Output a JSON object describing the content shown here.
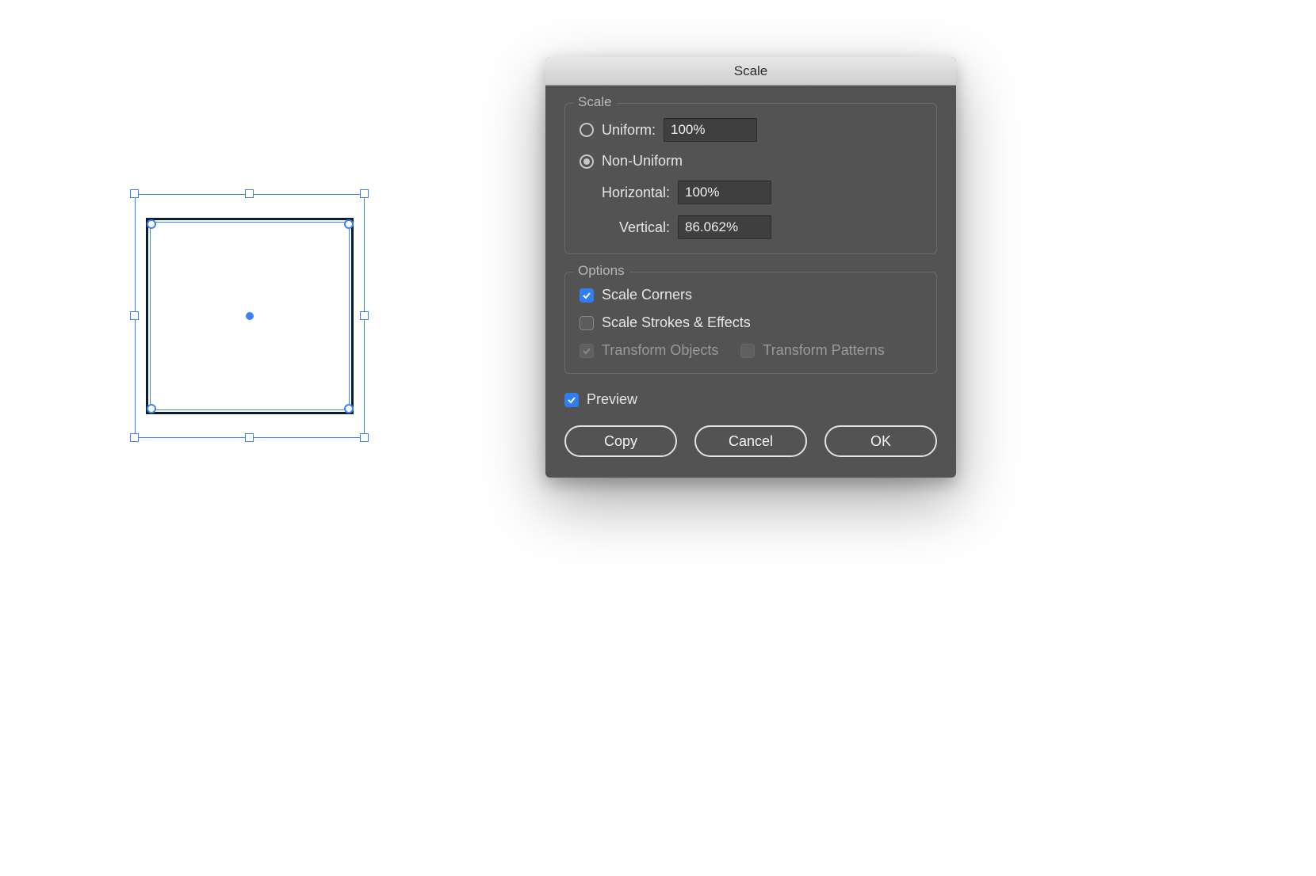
{
  "dialog": {
    "title": "Scale",
    "scale_group": {
      "label": "Scale",
      "uniform": {
        "label": "Uniform:",
        "value": "100%",
        "selected": false
      },
      "nonuniform": {
        "label": "Non-Uniform",
        "selected": true
      },
      "horizontal": {
        "label": "Horizontal:",
        "value": "100%"
      },
      "vertical": {
        "label": "Vertical:",
        "value": "86.062%"
      }
    },
    "options_group": {
      "label": "Options",
      "scale_corners": {
        "label": "Scale Corners",
        "checked": true
      },
      "scale_strokes": {
        "label": "Scale Strokes & Effects",
        "checked": false
      },
      "transform_objects": {
        "label": "Transform Objects",
        "checked": true,
        "disabled": true
      },
      "transform_patterns": {
        "label": "Transform Patterns",
        "checked": false,
        "disabled": true
      }
    },
    "preview": {
      "label": "Preview",
      "checked": true
    },
    "buttons": {
      "copy": "Copy",
      "cancel": "Cancel",
      "ok": "OK"
    }
  }
}
